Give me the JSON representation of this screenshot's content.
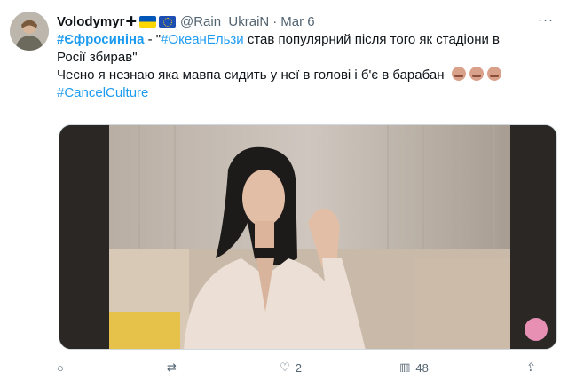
{
  "tweet": {
    "author": {
      "display_name": "Volodymyr",
      "plus": "✚",
      "handle": "@Rain_UkraiN",
      "date": "Mar 6",
      "separator": "·"
    },
    "text": {
      "hashtag1": "#Єфросиніна",
      "dash": " - \"",
      "hashtag2": "#ОкеанЕльзи",
      "rest_line1": " став популярний після того як стадіони в",
      "line2": "Росії збирав\"",
      "line3": "Чесно я незнаю яка мавпа сидить у неї в голові і б'є в барабан",
      "hashtag3": "#CancelCulture"
    },
    "emoji": [
      "see-no-evil-monkey",
      "see-no-evil-monkey",
      "see-no-evil-monkey"
    ],
    "actions": {
      "reply_count": "",
      "retweet_count": "",
      "like_count": "2",
      "views_count": "48"
    }
  },
  "colors": {
    "link": "#1d9bf0",
    "text": "#0f1419",
    "muted": "#536471",
    "flag_ua_top": "#0057b7",
    "flag_ua_bottom": "#ffd700",
    "flag_eu": "#1d4fb3"
  }
}
